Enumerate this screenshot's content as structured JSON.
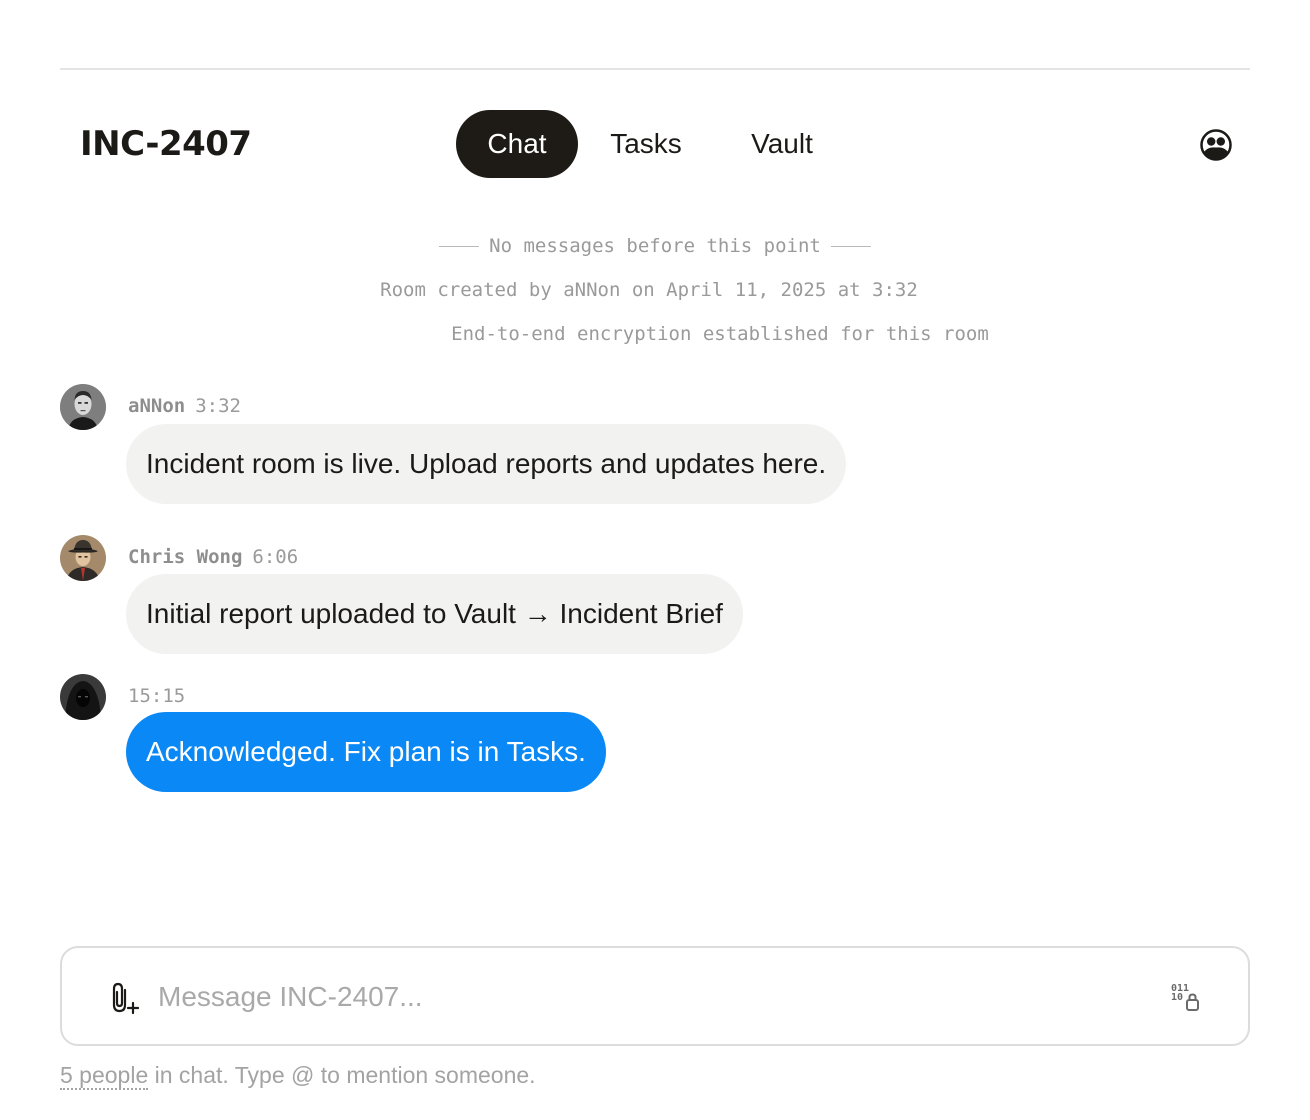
{
  "room": {
    "title": "INC-2407"
  },
  "tabs": [
    {
      "label": "Chat",
      "active": true
    },
    {
      "label": "Tasks",
      "active": false
    },
    {
      "label": "Vault",
      "active": false
    }
  ],
  "icons": {
    "people": "people-icon",
    "attach": "paperclip-plus-icon",
    "encryption": "binary-lock-icon"
  },
  "system_messages": {
    "history_start": "No messages before this point",
    "room_created": "Room created by aNNon on April 11, 2025 at 3:32",
    "encryption": "End-to-end encryption established for this room"
  },
  "messages": [
    {
      "author": "aNNon",
      "time": "3:32",
      "text": "Incident room is live. Upload reports and updates here.",
      "own": false
    },
    {
      "author": "Chris Wong",
      "time": "6:06",
      "text": "Initial report uploaded to Vault → Incident Brief",
      "own": false
    },
    {
      "author": "",
      "time": "15:15",
      "text": "Acknowledged. Fix plan is in Tasks.",
      "own": true
    }
  ],
  "composer": {
    "placeholder": "Message INC-2407..."
  },
  "footer": {
    "people_link": "5 people",
    "hint": " in chat. Type @ to mention someone."
  },
  "colors": {
    "accent": "#0a88f5",
    "active_tab": "#1e1b16",
    "bubble": "#f2f2f1"
  }
}
